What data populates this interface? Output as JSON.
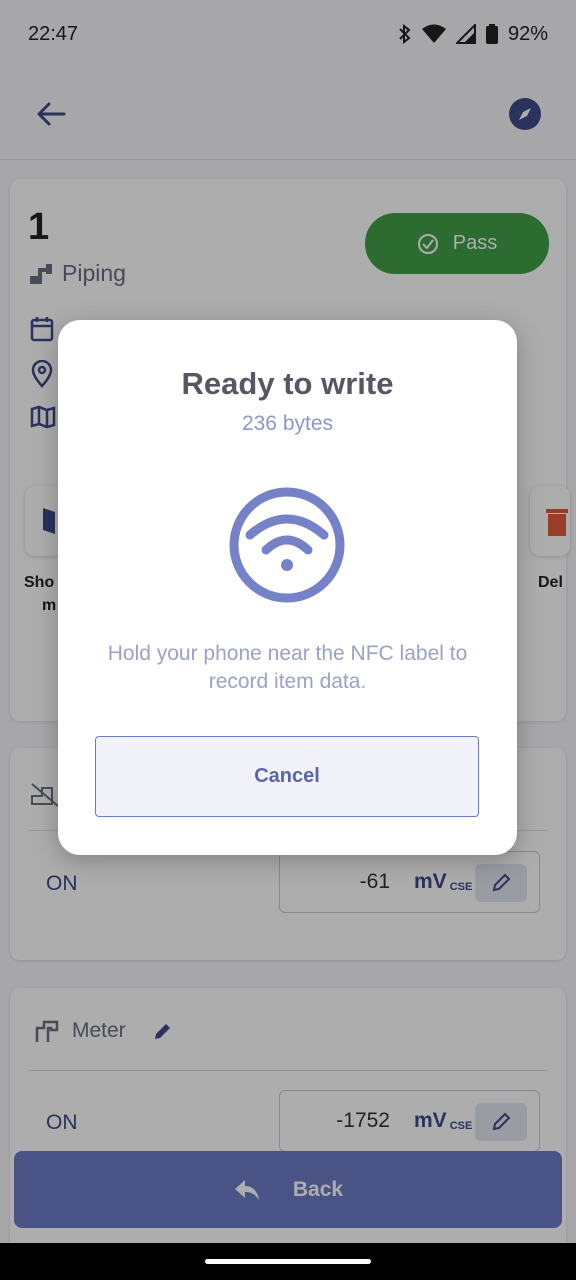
{
  "status_bar": {
    "time": "22:47",
    "battery": "92%"
  },
  "app_bar": {
    "back_icon": "arrow-left-icon",
    "compass_icon": "compass-icon"
  },
  "item": {
    "number": "1",
    "category": "Piping",
    "status_label": "Pass"
  },
  "actions": {
    "left_label_line1": "Sho",
    "left_label_line2": "m",
    "right_label": "Del"
  },
  "reading1": {
    "state": "ON",
    "value": "-61",
    "unit": "mV",
    "unit_sub": "CSE"
  },
  "meter": {
    "label": "Meter"
  },
  "reading2": {
    "state": "ON",
    "value": "-1752",
    "unit": "mV",
    "unit_sub": "CSE"
  },
  "back_button": {
    "label": "Back"
  },
  "dialog": {
    "title": "Ready to write",
    "subtitle": "236 bytes",
    "message": "Hold your phone near the NFC label to record item data.",
    "cancel_label": "Cancel"
  },
  "colors": {
    "accent": "#6c7bc6",
    "pass_green": "#43a047",
    "nfc_icon": "#7682c8"
  }
}
